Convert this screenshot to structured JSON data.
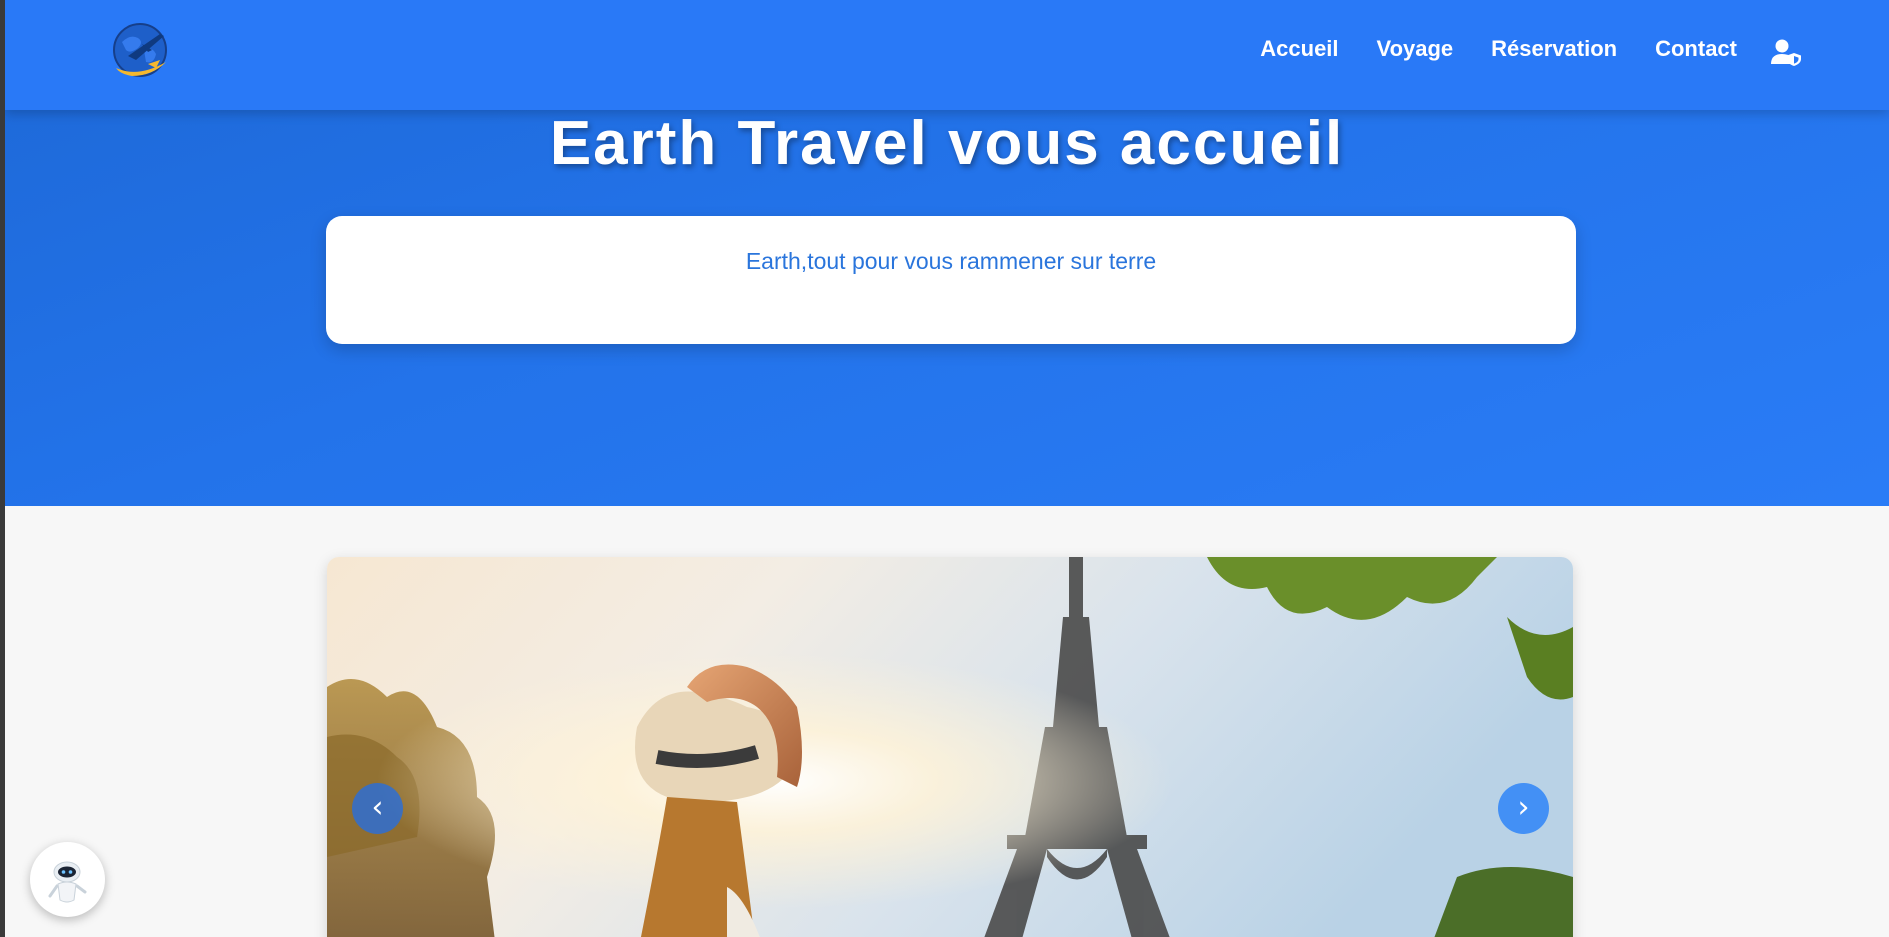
{
  "header": {
    "logo_icon": "globe-airplane-logo-icon",
    "nav": [
      {
        "label": "Accueil"
      },
      {
        "label": "Voyage"
      },
      {
        "label": "Réservation"
      },
      {
        "label": "Contact"
      }
    ],
    "user_icon": "user-shield-icon"
  },
  "hero": {
    "title": "Earth Travel vous accueil",
    "tagline": "Earth,tout pour vous rammener sur terre"
  },
  "carousel": {
    "prev_label": "‹",
    "next_label": "›",
    "slide_description_icon": "eiffel-tower-photo"
  },
  "chatbot": {
    "icon": "robot-icon"
  },
  "colors": {
    "brand_blue": "#2979f7",
    "tagline_blue": "#2a75dc",
    "page_bg": "#f7f7f7"
  }
}
